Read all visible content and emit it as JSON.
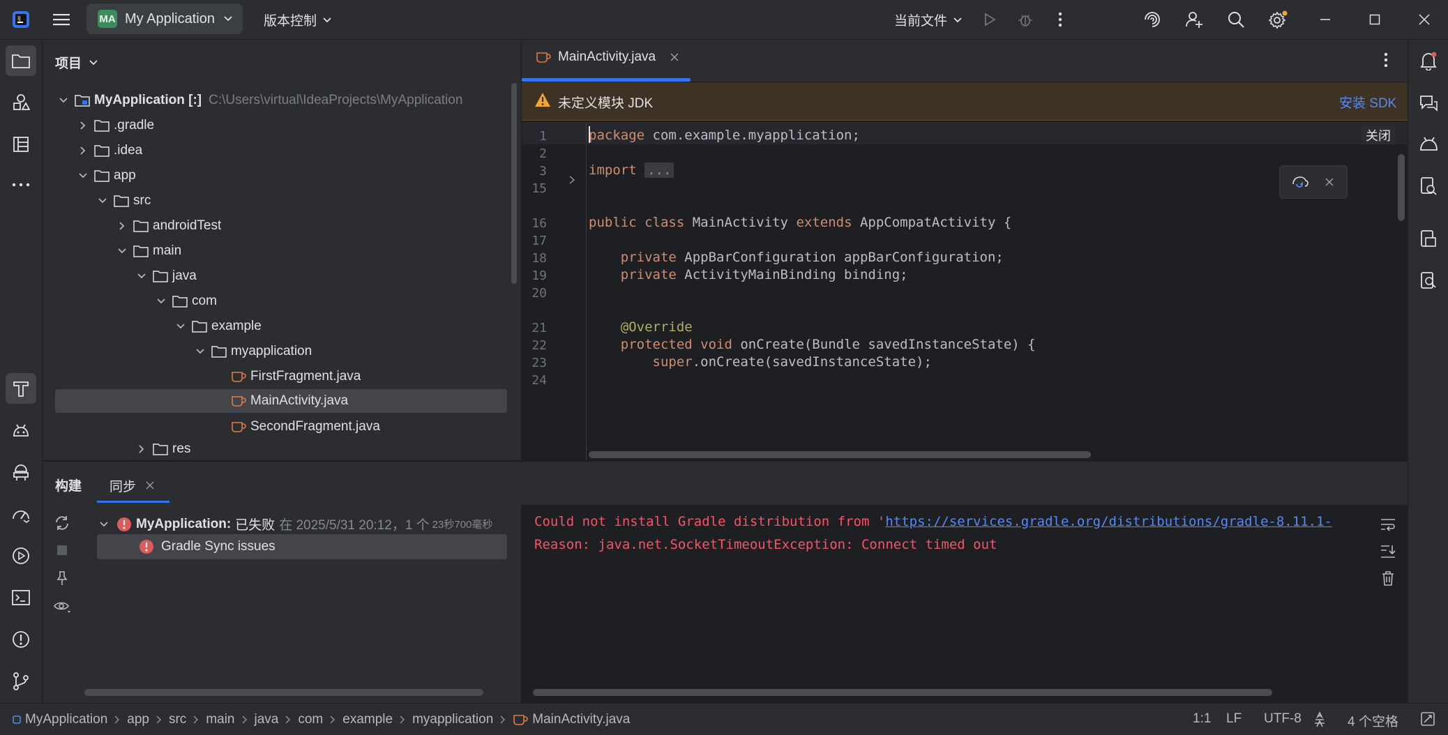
{
  "titlebar": {
    "project_badge": "MA",
    "project_name": "My Application",
    "vcs_menu": "版本控制",
    "run_config": "当前文件"
  },
  "left_strip": {
    "icons": [
      "folder-icon",
      "shapes-icon",
      "structure-icon",
      "more-icon",
      "build-hammer-icon",
      "android-icon",
      "device-manager-icon",
      "profiler-icon",
      "run-icon",
      "terminal-icon",
      "problems-icon",
      "git-icon"
    ]
  },
  "project_panel": {
    "title": "项目",
    "root_name": "MyApplication [:]",
    "root_path": "C:\\Users\\virtual\\IdeaProjects\\MyApplication",
    "items": [
      {
        "label": ".gradle"
      },
      {
        "label": ".idea"
      },
      {
        "label": "app"
      },
      {
        "label": "src"
      },
      {
        "label": "androidTest"
      },
      {
        "label": "main"
      },
      {
        "label": "java"
      },
      {
        "label": "com"
      },
      {
        "label": "example"
      },
      {
        "label": "myapplication"
      },
      {
        "label": "FirstFragment.java"
      },
      {
        "label": "MainActivity.java"
      },
      {
        "label": "SecondFragment.java"
      },
      {
        "label": "res"
      }
    ]
  },
  "editor": {
    "tab_label": "MainActivity.java",
    "banner_text": "未定义模块 JDK",
    "banner_action": "安装 SDK",
    "close_hint": "关闭",
    "lines": [
      {
        "n": "1",
        "parts": [
          {
            "c": "kw",
            "t": "package"
          },
          {
            "c": "",
            "t": " com.example.myapplication;"
          }
        ]
      },
      {
        "n": "2",
        "parts": []
      },
      {
        "n": "3",
        "parts": [
          {
            "c": "kw",
            "t": "import"
          },
          {
            "c": "",
            "t": " "
          },
          {
            "c": "fold",
            "t": "..."
          }
        ]
      },
      {
        "n": "15",
        "parts": []
      },
      {
        "n": "16",
        "parts": [
          {
            "c": "kw",
            "t": "public class"
          },
          {
            "c": "",
            "t": " MainActivity "
          },
          {
            "c": "kw",
            "t": "extends"
          },
          {
            "c": "",
            "t": " AppCompatActivity {"
          }
        ]
      },
      {
        "n": "17",
        "parts": []
      },
      {
        "n": "18",
        "parts": [
          {
            "c": "",
            "t": "    "
          },
          {
            "c": "kw",
            "t": "private"
          },
          {
            "c": "",
            "t": " AppBarConfiguration appBarConfiguration;"
          }
        ]
      },
      {
        "n": "19",
        "parts": [
          {
            "c": "",
            "t": "    "
          },
          {
            "c": "kw",
            "t": "private"
          },
          {
            "c": "",
            "t": " ActivityMainBinding binding;"
          }
        ]
      },
      {
        "n": "20",
        "parts": []
      },
      {
        "n": "21",
        "parts": [
          {
            "c": "",
            "t": "    "
          },
          {
            "c": "ann",
            "t": "@Override"
          }
        ]
      },
      {
        "n": "22",
        "parts": [
          {
            "c": "",
            "t": "    "
          },
          {
            "c": "kw",
            "t": "protected void"
          },
          {
            "c": "",
            "t": " onCreate(Bundle savedInstanceState) {"
          }
        ]
      },
      {
        "n": "23",
        "parts": [
          {
            "c": "",
            "t": "        "
          },
          {
            "c": "kw",
            "t": "super"
          },
          {
            "c": "",
            "t": ".onCreate(savedInstanceState);"
          }
        ]
      },
      {
        "n": "24",
        "parts": []
      }
    ]
  },
  "build": {
    "tab_build": "构建",
    "tab_sync": "同步",
    "result_project": "MyApplication:",
    "result_status": "已失败",
    "result_time": "在 2025/5/31 20:12，1 个",
    "result_duration": "23秒700毫秒",
    "issue_label": "Gradle Sync issues",
    "console_line1_prefix": "Could not install Gradle distribution from '",
    "console_line1_link": "https://services.gradle.org/distributions/gradle-8.11.1-",
    "console_line2": "Reason: java.net.SocketTimeoutException: Connect timed out"
  },
  "statusbar": {
    "breadcrumbs": [
      "MyApplication",
      "app",
      "src",
      "main",
      "java",
      "com",
      "example",
      "myapplication",
      "MainActivity.java"
    ],
    "position": "1:1",
    "line_sep": "LF",
    "encoding": "UTF-8",
    "indent": "4 个空格"
  },
  "colors": {
    "accent": "#3574f0",
    "error": "#f75464",
    "keyword": "#cf8e6d",
    "warning_bg": "#3d3223"
  }
}
